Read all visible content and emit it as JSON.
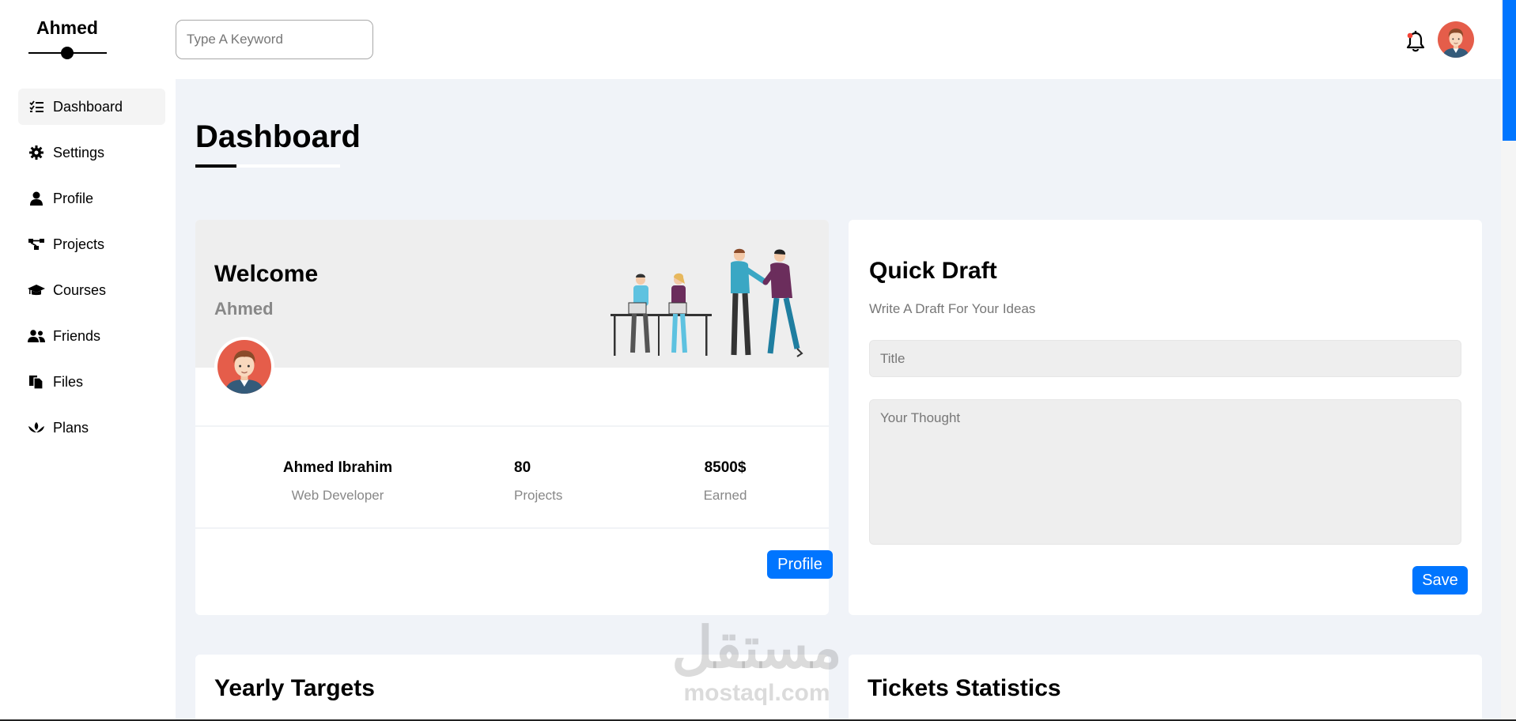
{
  "sidebar": {
    "logo": "Ahmed",
    "items": [
      {
        "label": "Dashboard",
        "icon": "list-check-icon",
        "active": true
      },
      {
        "label": "Settings",
        "icon": "gear-icon",
        "active": false
      },
      {
        "label": "Profile",
        "icon": "user-icon",
        "active": false
      },
      {
        "label": "Projects",
        "icon": "diagram-project-icon",
        "active": false
      },
      {
        "label": "Courses",
        "icon": "graduation-cap-icon",
        "active": false
      },
      {
        "label": "Friends",
        "icon": "users-icon",
        "active": false
      },
      {
        "label": "Files",
        "icon": "files-icon",
        "active": false
      },
      {
        "label": "Plans",
        "icon": "plans-icon",
        "active": false
      }
    ]
  },
  "header": {
    "search_placeholder": "Type A Keyword",
    "notification_icon": "bell-icon",
    "avatar_icon": "avatar-icon"
  },
  "main": {
    "page_title": "Dashboard",
    "welcome": {
      "title": "Welcome",
      "name": "Ahmed",
      "stats": [
        {
          "value": "Ahmed Ibrahim",
          "label": "Web Developer"
        },
        {
          "value": "80",
          "label": "Projects"
        },
        {
          "value": "8500$",
          "label": "Earned"
        }
      ],
      "button": "Profile"
    },
    "quick_draft": {
      "title": "Quick Draft",
      "subtitle": "Write A Draft For Your Ideas",
      "title_placeholder": "Title",
      "body_placeholder": "Your Thought",
      "button": "Save"
    },
    "yearly_targets": {
      "title": "Yearly Targets"
    },
    "tickets_statistics": {
      "title": "Tickets Statistics"
    }
  },
  "watermark": {
    "arabic": "مستقل",
    "latin": "mostaql.com"
  },
  "colors": {
    "accent": "#0075ff",
    "background": "#f0f3f8",
    "notification": "#f44336"
  }
}
